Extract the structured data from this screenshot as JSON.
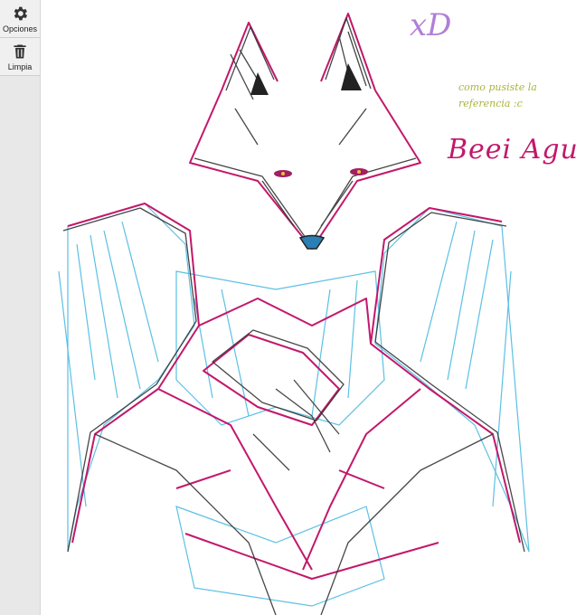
{
  "toolbar": {
    "options_label": "Opciones",
    "options_icon": "gear-icon",
    "clear_label": "Limpia",
    "clear_icon": "trash-icon"
  },
  "canvas": {
    "note_xd": "xD",
    "note_reference": "como pusiste la referencia :c",
    "signature": "Beei Agus",
    "colors": {
      "pink": "#c2186b",
      "blue": "#3fb6e0",
      "gray": "#333333",
      "note_green": "#a9b43a",
      "xd_purple": "#b07fd6"
    }
  }
}
